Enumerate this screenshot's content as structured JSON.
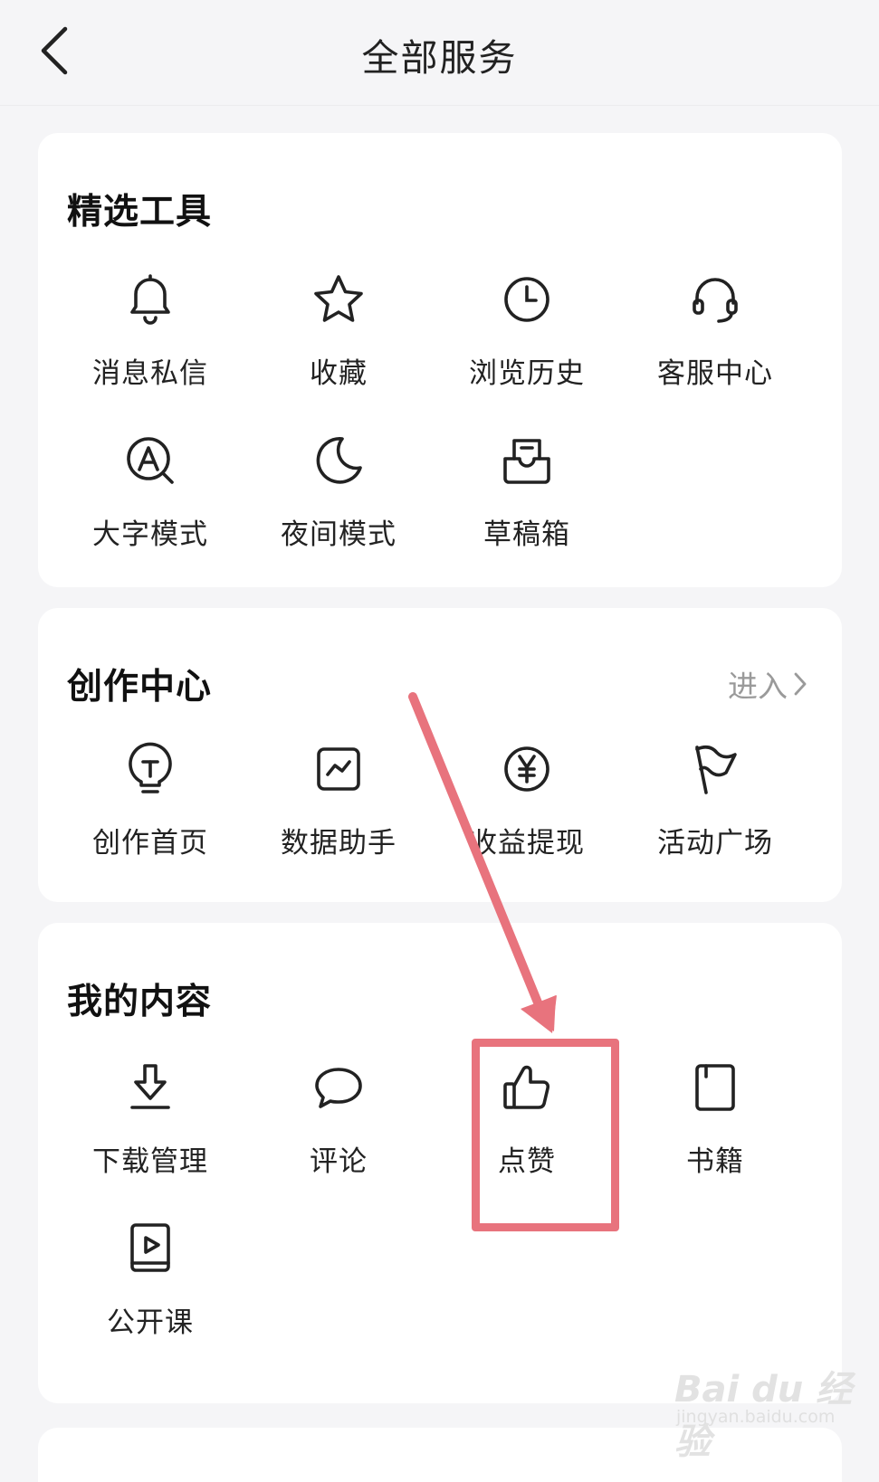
{
  "header": {
    "title": "全部服务",
    "back_icon": "back-chevron-icon"
  },
  "sections": {
    "featured": {
      "title": "精选工具",
      "items": [
        {
          "label": "消息私信",
          "icon": "bell-icon"
        },
        {
          "label": "收藏",
          "icon": "star-icon"
        },
        {
          "label": "浏览历史",
          "icon": "clock-icon"
        },
        {
          "label": "客服中心",
          "icon": "headset-icon"
        },
        {
          "label": "大字模式",
          "icon": "large-text-icon"
        },
        {
          "label": "夜间模式",
          "icon": "moon-icon"
        },
        {
          "label": "草稿箱",
          "icon": "drafts-inbox-icon"
        }
      ]
    },
    "creation": {
      "title": "创作中心",
      "enter_label": "进入",
      "items": [
        {
          "label": "创作首页",
          "icon": "lightbulb-icon"
        },
        {
          "label": "数据助手",
          "icon": "chart-icon"
        },
        {
          "label": "收益提现",
          "icon": "yen-coin-icon"
        },
        {
          "label": "活动广场",
          "icon": "flag-icon"
        }
      ]
    },
    "my_content": {
      "title": "我的内容",
      "items": [
        {
          "label": "下载管理",
          "icon": "download-icon"
        },
        {
          "label": "评论",
          "icon": "comment-bubble-icon"
        },
        {
          "label": "点赞",
          "icon": "thumbs-up-icon"
        },
        {
          "label": "书籍",
          "icon": "book-icon"
        },
        {
          "label": "公开课",
          "icon": "video-course-icon"
        }
      ]
    }
  },
  "annotation": {
    "highlight_color": "#e8737d",
    "highlighted_item": "点赞"
  },
  "watermark": {
    "main": "Bai du 经验",
    "sub": "jingyan.baidu.com"
  }
}
